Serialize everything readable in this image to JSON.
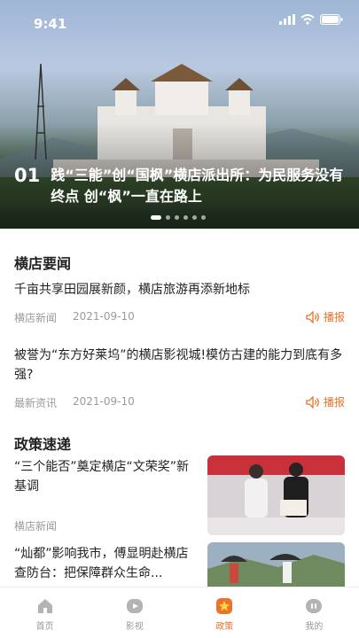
{
  "status": {
    "time": "9:41"
  },
  "hero": {
    "number": "01",
    "title": "践“三能”创“国枫”横店派出所：为民服务没有终点 创“枫”一直在路上"
  },
  "news_section": {
    "title": "横店要闻",
    "items": [
      {
        "title": "千亩共享田园展新颜，横店旅游再添新地标",
        "source": "横店新闻",
        "date": "2021-09-10",
        "action": "播报"
      },
      {
        "title": "被誉为“东方好莱坞”的横店影视城!模仿古建的能力到底有多强?",
        "source": "最新资讯",
        "date": "2021-09-10",
        "action": "播报"
      }
    ]
  },
  "policy_section": {
    "title": "政策速递",
    "items": [
      {
        "title": "“三个能否”奠定横店“文荣奖”新基调",
        "source": "横店新闻"
      },
      {
        "title": "“灿都”影响我市，傅显明赴横店查防台：把保障群众生命...",
        "source": ""
      }
    ]
  },
  "tabs": [
    {
      "label": "首页",
      "icon": "home-icon",
      "active": false
    },
    {
      "label": "影视",
      "icon": "video-icon",
      "active": false
    },
    {
      "label": "政策",
      "icon": "star-icon",
      "active": true
    },
    {
      "label": "我的",
      "icon": "profile-icon",
      "active": false
    }
  ],
  "colors": {
    "accent": "#e8742a",
    "muted": "#9a9a9a"
  }
}
